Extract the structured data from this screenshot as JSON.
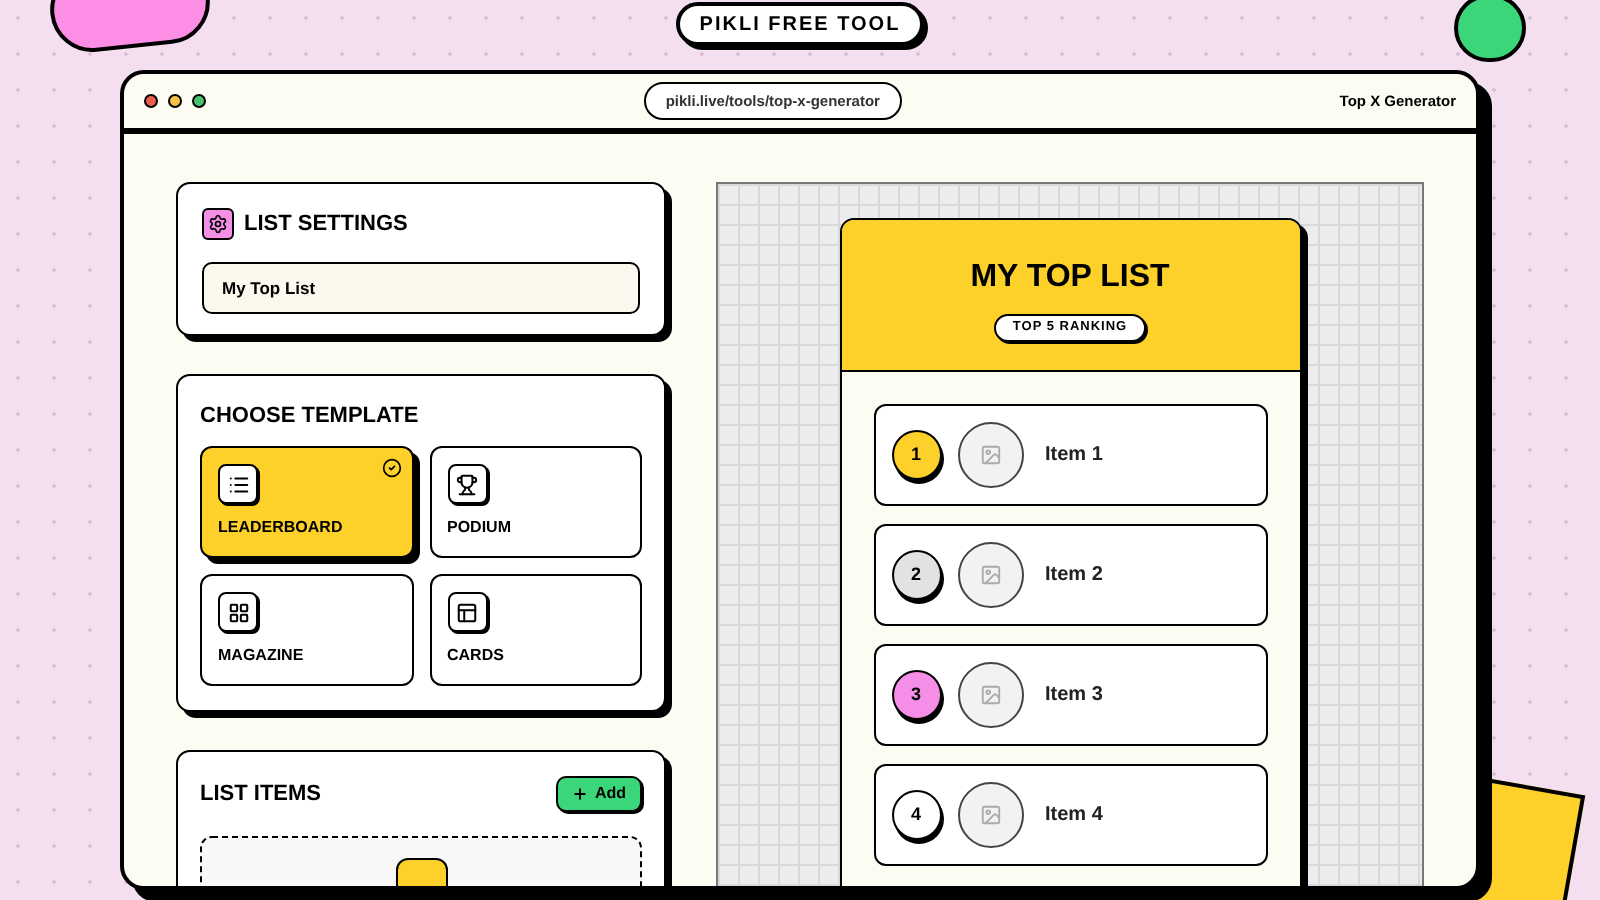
{
  "badge": "PIKLI FREE TOOL",
  "window": {
    "url": "pikli.live/tools/top-x-generator",
    "title": "Top X Generator"
  },
  "list_settings": {
    "title": "LIST SETTINGS",
    "name_field": {
      "value": "My Top List"
    }
  },
  "choose_template": {
    "title": "CHOOSE TEMPLATE",
    "templates": [
      {
        "label": "LEADERBOARD",
        "kind": "list",
        "selected": true
      },
      {
        "label": "PODIUM",
        "kind": "trophy",
        "selected": false
      },
      {
        "label": "MAGAZINE",
        "kind": "grid",
        "selected": false
      },
      {
        "label": "CARDS",
        "kind": "layout",
        "selected": false
      }
    ]
  },
  "list_items": {
    "title": "LIST ITEMS",
    "add_button": "Add"
  },
  "preview": {
    "title": "MY TOP LIST",
    "subtitle": "TOP 5 RANKING",
    "items": [
      {
        "rank": "1",
        "name": "Item 1",
        "color": "#fdd02a"
      },
      {
        "rank": "2",
        "name": "Item 2",
        "color": "#e2e2e2"
      },
      {
        "rank": "3",
        "name": "Item 3",
        "color": "#f48ee6"
      },
      {
        "rank": "4",
        "name": "Item 4",
        "color": "#ffffff"
      }
    ]
  }
}
